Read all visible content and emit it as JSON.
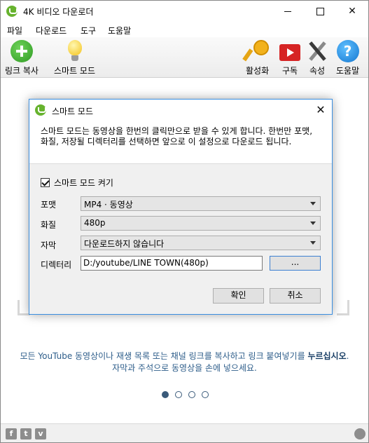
{
  "window": {
    "title": "4K 비디오 다운로더",
    "minimize": "",
    "maximize": "",
    "close": "✕"
  },
  "menu": [
    "파일",
    "다운로드",
    "도구",
    "도움말"
  ],
  "toolbar": {
    "paste_link": "링크 복사",
    "smart_mode": "스마트 모드",
    "activate": "활성화",
    "subscribe": "구독",
    "preferences": "속성",
    "help": "도움말",
    "help_glyph": "?"
  },
  "main": {
    "message_line1_pre": "모든 YouTube 동영상이나 재생 목록 또는 채널 링크를 복사하고 링크 붙여넣기를 ",
    "message_line1_bold": "누르십시오",
    "message_line1_post": ".",
    "message_line2": "자막과 주석으로 동영상을 손에 넣으세요.",
    "pager": {
      "count": 4,
      "active": 1
    }
  },
  "statusbar": {
    "facebook": "f",
    "twitter": "t",
    "vimeo": "v"
  },
  "dialog": {
    "title": "스마트 모드",
    "close": "✕",
    "description": "스마트 모드는 동영상을 한번의 클릭만으로 받을 수 있게 합니다. 한번만 포맷, 화질, 저장될 디렉터리를 선택하면 앞으로 이 설정으로 다운로드 됩니다.",
    "enable_label": "스마트 모드 켜기",
    "enable_checked": true,
    "format_label": "포맷",
    "format_value": "MP4 · 동영상",
    "quality_label": "화질",
    "quality_value": "480p",
    "subtitles_label": "자막",
    "subtitles_value": "다운로드하지 않습니다",
    "directory_label": "디렉터리",
    "directory_value": "D:/youtube/LINE TOWN(480p)",
    "browse_label": "...",
    "ok_label": "확인",
    "cancel_label": "취소"
  }
}
